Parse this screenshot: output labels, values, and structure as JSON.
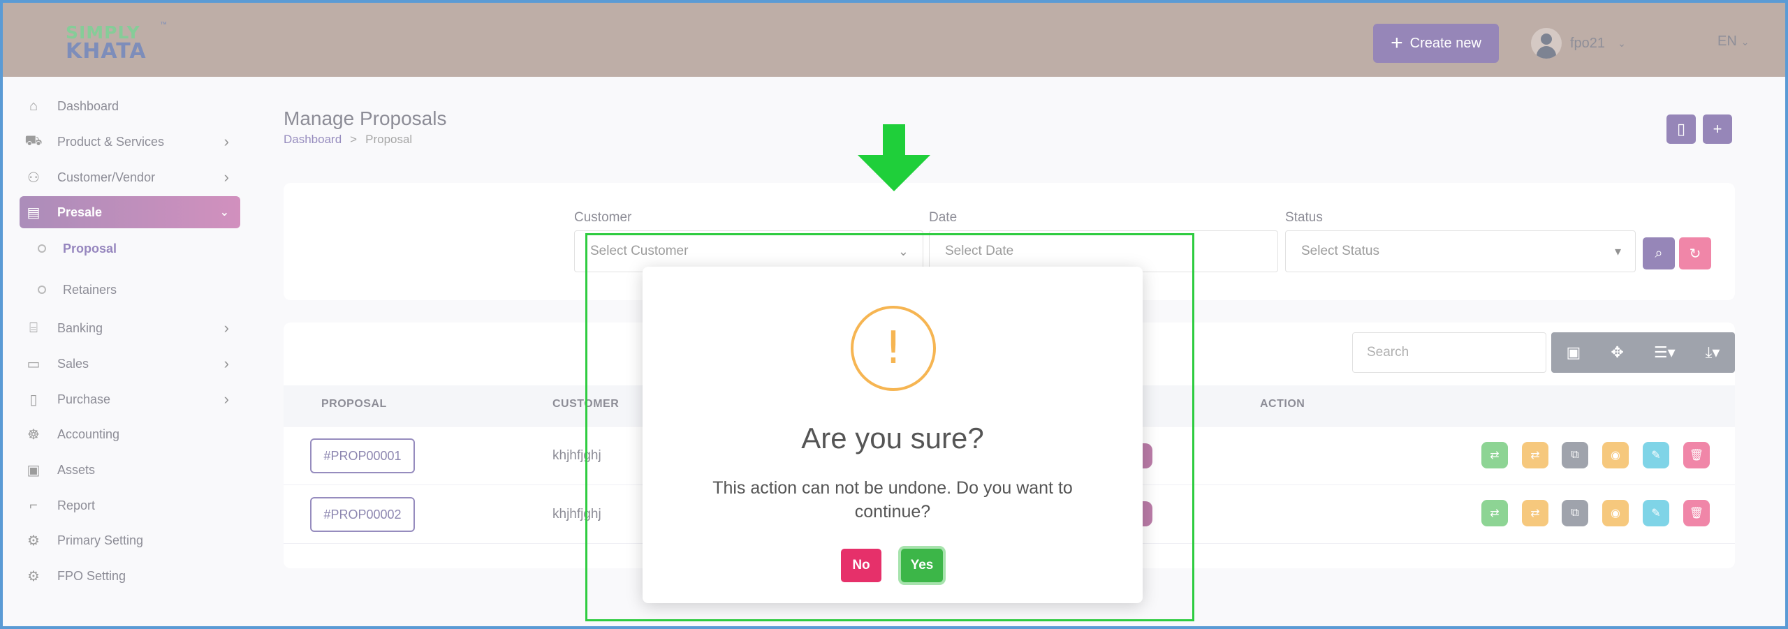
{
  "header": {
    "logo_line1": "SIMPLY",
    "logo_line2": "KHATA",
    "logo_tm": "™",
    "create_label": "Create new",
    "user_name": "fpo21",
    "language": "EN"
  },
  "sidebar": {
    "items": [
      {
        "label": "Dashboard",
        "icon": "home-icon",
        "glyph": "⌂",
        "has_arrow": false
      },
      {
        "label": "Product & Services",
        "icon": "cart-icon",
        "glyph": "⛟",
        "has_arrow": true
      },
      {
        "label": "Customer/Vendor",
        "icon": "user-plus-icon",
        "glyph": "⚇",
        "has_arrow": true
      },
      {
        "label": "Presale",
        "icon": "clipboard-icon",
        "glyph": "▤",
        "has_arrow": true,
        "active": true
      },
      {
        "label": "Banking",
        "icon": "bank-icon",
        "glyph": "⌸",
        "has_arrow": true
      },
      {
        "label": "Sales",
        "icon": "document-icon",
        "glyph": "▭",
        "has_arrow": true
      },
      {
        "label": "Purchase",
        "icon": "receipt-icon",
        "glyph": "▯",
        "has_arrow": true
      },
      {
        "label": "Accounting",
        "icon": "accounting-icon",
        "glyph": "☸",
        "has_arrow": false
      },
      {
        "label": "Assets",
        "icon": "assets-icon",
        "glyph": "▣",
        "has_arrow": false
      },
      {
        "label": "Report",
        "icon": "report-icon",
        "glyph": "⌐",
        "has_arrow": false
      },
      {
        "label": "Primary Setting",
        "icon": "settings-icon",
        "glyph": "⚙",
        "has_arrow": false
      },
      {
        "label": "FPO Setting",
        "icon": "gear-icon",
        "glyph": "⚙",
        "has_arrow": false
      }
    ],
    "sub_items": [
      {
        "label": "Proposal",
        "current": true
      },
      {
        "label": "Retainers",
        "current": false
      }
    ]
  },
  "page": {
    "title": "Manage Proposals",
    "breadcrumb_home": "Dashboard",
    "breadcrumb_sep": ">",
    "breadcrumb_current": "Proposal"
  },
  "filters": {
    "customer_label": "Customer",
    "customer_value": "Select Customer",
    "date_label": "Date",
    "date_placeholder": "Select Date",
    "status_label": "Status",
    "status_value": "Select Status"
  },
  "table": {
    "search_placeholder": "Search",
    "columns": [
      "PROPOSAL",
      "CUSTOMER",
      "ACTION"
    ],
    "rows": [
      {
        "proposal": "#PROP00001",
        "customer": "khjhfjghj"
      },
      {
        "proposal": "#PROP00002",
        "customer": "khjhfjghj"
      }
    ]
  },
  "modal": {
    "icon_glyph": "!",
    "title": "Are you sure?",
    "text": "This action can not be undone. Do you want to continue?",
    "no_label": "No",
    "yes_label": "Yes"
  },
  "colors": {
    "header_bg": "#8f7468",
    "primary": "#4a2f85",
    "danger": "#e6306a",
    "success": "#3cb648",
    "warning": "#f6b552"
  }
}
